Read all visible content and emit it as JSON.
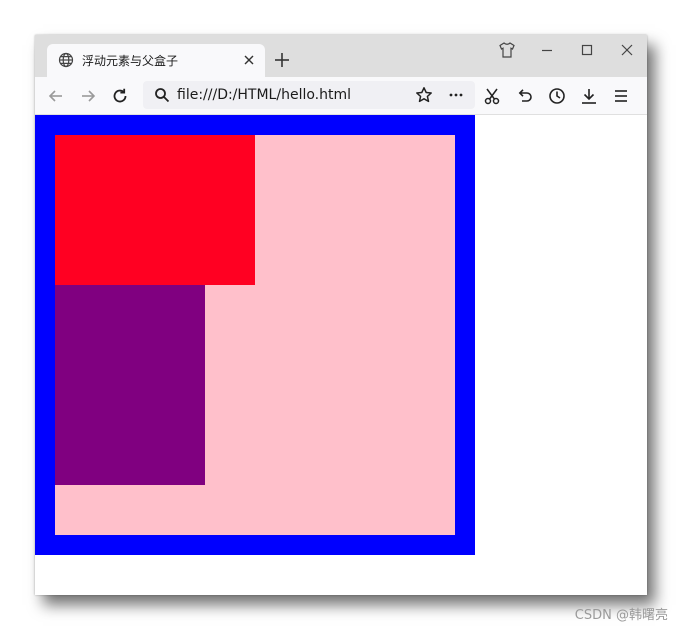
{
  "browser": {
    "tab": {
      "title": "浮动元素与父盒子",
      "favicon": "globe-icon",
      "close_icon": "close-icon"
    },
    "new_tab_icon": "plus-icon",
    "window_controls": [
      "shirt-icon",
      "minimize-icon",
      "maximize-icon",
      "close-icon"
    ],
    "toolbar": {
      "back_icon": "arrow-left-icon",
      "forward_icon": "arrow-right-icon",
      "reload_icon": "reload-icon",
      "url": "file:///D:/HTML/hello.html",
      "url_icons": [
        "search-icon",
        "star-icon",
        "more-icon"
      ],
      "right_icons": [
        "scissors-icon",
        "undo-icon",
        "history-icon",
        "download-icon",
        "menu-icon"
      ]
    }
  },
  "page": {
    "colors": {
      "parent_border": "#0000ff",
      "parent_background": "#ffc0cb",
      "float_box_1": "#ff0022",
      "float_box_2": "#800080"
    }
  },
  "watermark": "CSDN @韩曙亮"
}
